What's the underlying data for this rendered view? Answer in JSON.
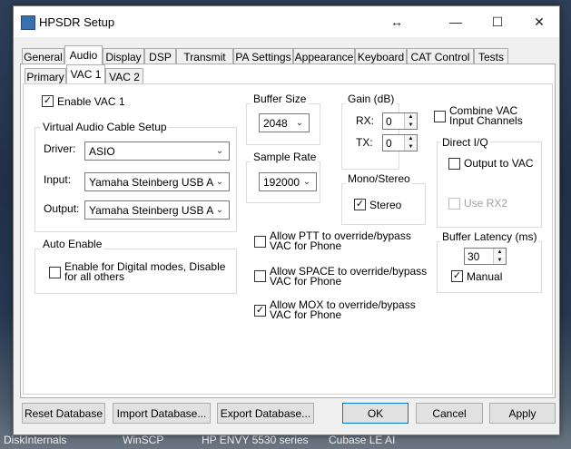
{
  "window": {
    "title": "HPSDR Setup"
  },
  "tabs": [
    "General",
    "Audio",
    "Display",
    "DSP",
    "Transmit",
    "PA Settings",
    "Appearance",
    "Keyboard",
    "CAT Control",
    "Tests"
  ],
  "subtabs": [
    "Primary",
    "VAC 1",
    "VAC 2"
  ],
  "vac1": {
    "enable_vac1": "Enable VAC 1",
    "setup_group": "Virtual Audio Cable Setup",
    "driver_label": "Driver:",
    "driver_value": "ASIO",
    "input_label": "Input:",
    "input_value": "Yamaha Steinberg USB ASIO",
    "output_label": "Output:",
    "output_value": "Yamaha Steinberg USB ASIO",
    "auto_enable_group": "Auto Enable",
    "auto_enable_line1": "Enable for Digital modes, Disable",
    "auto_enable_line2": "for all others",
    "buffer_size_group": "Buffer Size",
    "buffer_size_value": "2048",
    "sample_rate_group": "Sample Rate",
    "sample_rate_value": "192000",
    "gain_group": "Gain (dB)",
    "rx_label": "RX:",
    "rx_value": "0",
    "tx_label": "TX:",
    "tx_value": "0",
    "mono_stereo_group": "Mono/Stereo",
    "stereo_label": "Stereo",
    "combine_line1": "Combine VAC",
    "combine_line2": "Input Channels",
    "direct_iq_group": "Direct I/Q",
    "output_to_vac": "Output to VAC",
    "use_rx2": "Use RX2",
    "buffer_latency_group": "Buffer Latency (ms)",
    "latency_value": "30",
    "manual_label": "Manual",
    "allow_ptt_line1": "Allow PTT to override/bypass",
    "allow_ptt_line2": "VAC for Phone",
    "allow_space_line1": "Allow SPACE to override/bypass",
    "allow_space_line2": "VAC for Phone",
    "allow_mox_line1": "Allow MOX to override/bypass",
    "allow_mox_line2": "VAC for Phone"
  },
  "footer": {
    "reset": "Reset Database",
    "import": "Import Database...",
    "export": "Export Database...",
    "ok": "OK",
    "cancel": "Cancel",
    "apply": "Apply"
  },
  "taskbar": [
    "DiskInternals",
    "WinSCP",
    "HP ENVY 5530 series",
    "Cubase LE AI"
  ],
  "glyphs": {
    "check": "✓",
    "combo_arrow": "⌄",
    "spin_up": "▲",
    "spin_down": "▼",
    "resize": "↔",
    "minimize": "—",
    "maximize": "☐",
    "close": "✕"
  },
  "colors": {
    "accent": "#0078d7"
  }
}
